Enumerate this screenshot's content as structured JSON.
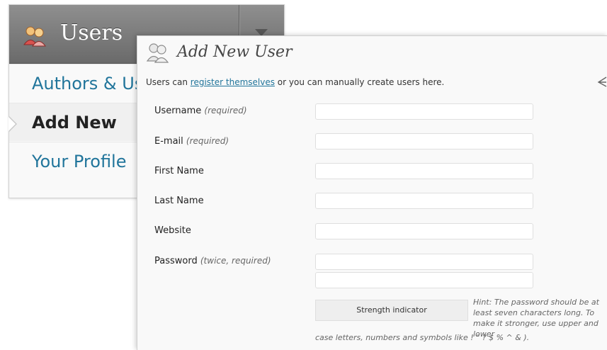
{
  "menu": {
    "title": "Users",
    "items": [
      {
        "label": "Authors & Users"
      },
      {
        "label": "Add New"
      },
      {
        "label": "Your Profile"
      }
    ]
  },
  "form": {
    "title": "Add New User",
    "intro_before": "Users can ",
    "intro_link": "register themselves",
    "intro_after": " or you can manually create users here.",
    "fields": {
      "username": {
        "label": "Username",
        "note": "(required)",
        "value": ""
      },
      "email": {
        "label": "E-mail",
        "note": "(required)",
        "value": ""
      },
      "first_name": {
        "label": "First Name",
        "value": ""
      },
      "last_name": {
        "label": "Last Name",
        "value": ""
      },
      "website": {
        "label": "Website",
        "value": ""
      },
      "password": {
        "label": "Password",
        "note": "(twice, required)",
        "value": "",
        "confirm_value": ""
      }
    },
    "strength_indicator": "Strength indicator",
    "hint_main": "Hint: The password should be at least seven characters long. To make it stronger, use upper and lower",
    "hint_tail": "case letters, numbers and symbols like ! \" ? $ % ^ & )."
  },
  "colors": {
    "link": "#21759b",
    "header_bg": "#7a7a7a",
    "panel_bg": "#f9f9f9"
  }
}
